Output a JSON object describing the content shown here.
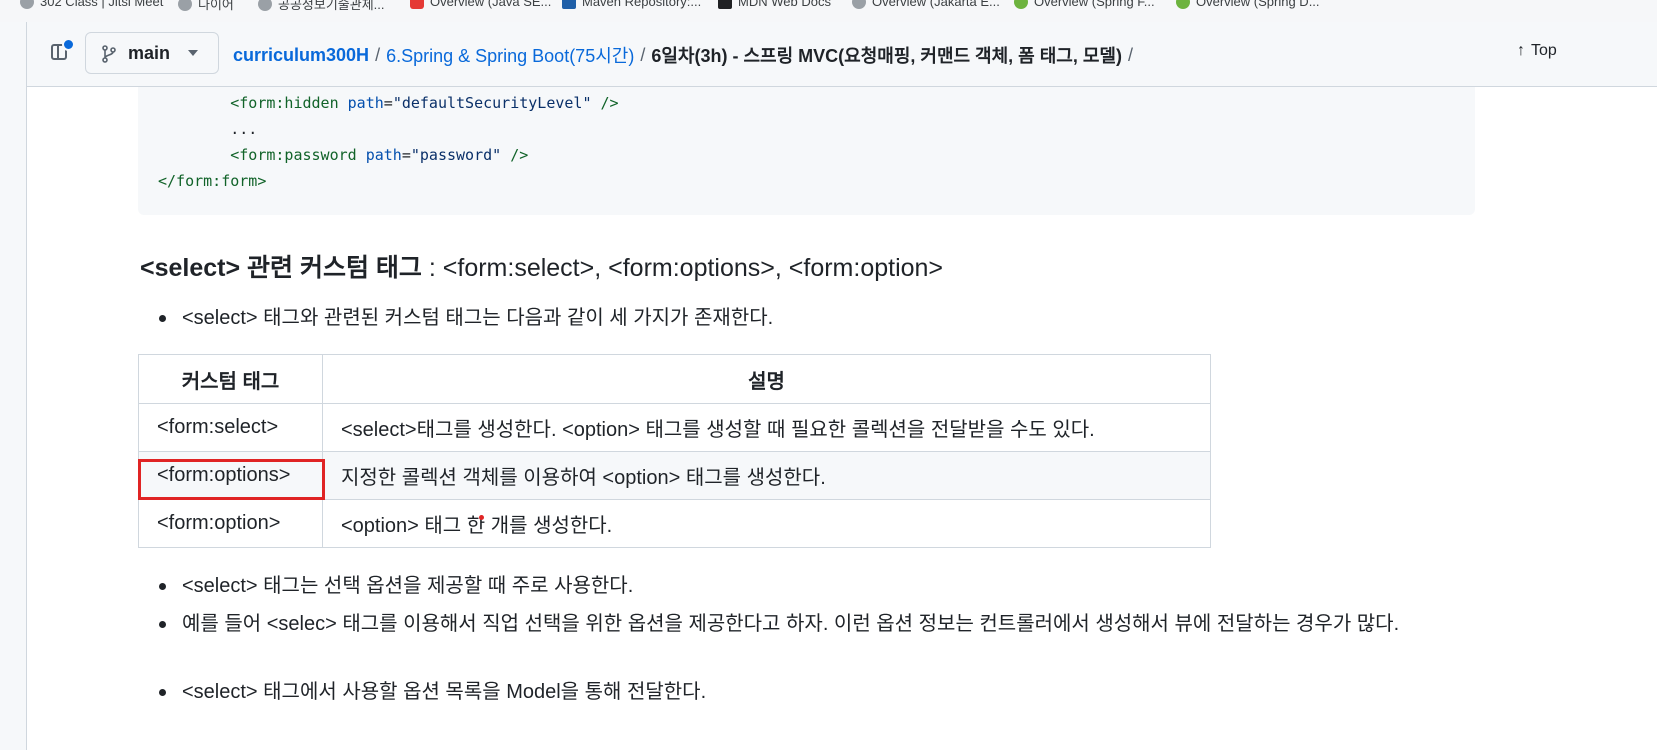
{
  "bookmarks": [
    {
      "label": "302 Class | Jitsi Meet",
      "icon": "globe-icon"
    },
    {
      "label": "다이어",
      "icon": "globe-icon"
    },
    {
      "label": "공공정보기술관제...",
      "icon": "globe-icon"
    },
    {
      "label": "Overview (Java SE...",
      "icon": "java-icon"
    },
    {
      "label": "Maven Repository:...",
      "icon": "maven-icon"
    },
    {
      "label": "MDN Web Docs",
      "icon": "mdn-icon"
    },
    {
      "label": "Overview (Jakarta E...",
      "icon": "globe-icon"
    },
    {
      "label": "Overview (Spring F...",
      "icon": "spring-icon"
    },
    {
      "label": "Overview (Spring D...",
      "icon": "spring-icon"
    }
  ],
  "header": {
    "branch": "main",
    "breadcrumb": {
      "repo": "curriculum300H",
      "folder": "6.Spring & Spring Boot(75시간)",
      "file": "6일차(3h) - 스프링 MVC(요청매핑, 커맨드 객체, 폼 태그, 모델)",
      "separator": "/"
    },
    "top_label": "Top"
  },
  "code": {
    "lines": [
      {
        "indent": "        ",
        "tag_open": "<form:hidden",
        "attr": "path",
        "value": "\"defaultSecurityLevel\"",
        "tag_close": " />"
      },
      {
        "indent": "        ",
        "text": "..."
      },
      {
        "indent": "        ",
        "tag_open": "<form:password",
        "attr": "path",
        "value": "\"password\"",
        "tag_close": " />"
      },
      {
        "indent": "",
        "text_tag": "</form:form>"
      }
    ]
  },
  "section": {
    "heading_bold": "<select> 관련 커스텀 태그",
    "heading_rest": " : <form:select>, <form:options>, <form:option>",
    "intro": "<select> 태그와 관련된 커스텀 태그는 다음과 같이 세 가지가 존재한다.",
    "table": {
      "headers": [
        "커스텀 태그",
        "설명"
      ],
      "rows": [
        [
          "<form:select>",
          "<select>태그를 생성한다. <option> 태그를 생성할 때 필요한 콜렉션을 전달받을 수도 있다."
        ],
        [
          "<form:options>",
          "지정한 콜렉션 객체를 이용하여 <option> 태그를 생성한다."
        ],
        [
          "<form:option>",
          "<option> 태그 한 개를 생성한다."
        ]
      ]
    },
    "bullets": [
      "<select> 태그는 선택 옵션을 제공할 때 주로 사용한다.",
      "예를 들어 <selec> 태그를 이용해서 직업 선택을 위한 옵션을 제공한다고 하자. 이런 옵션 정보는 컨트롤러에서 생성해서 뷰에 전달하는 경우가 많다.",
      "<select> 태그에서 사용할 옵션 목록을 Model을 통해 전달한다."
    ]
  },
  "colors": {
    "link": "#0969da",
    "highlight": "#e02424",
    "header_bg": "#f6f8fa"
  }
}
